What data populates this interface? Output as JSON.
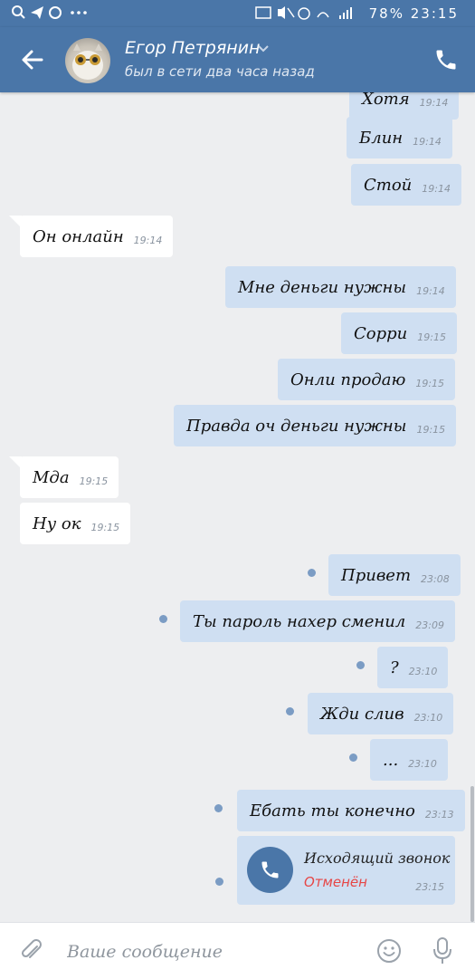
{
  "status_bar": {
    "left_icons": "🔍◢ ⋯",
    "battery": "78%",
    "time": "23:15"
  },
  "header": {
    "contact_name": "Егор Петрянин",
    "contact_status": "был в сети два часа назад",
    "icons": {
      "back": "arrow-left-icon",
      "call": "phone-icon",
      "dropdown": "chevron-down-icon"
    }
  },
  "messages": [
    {
      "id": "m0",
      "dir": "out",
      "text": "Хотя",
      "time": "19:14"
    },
    {
      "id": "m1",
      "dir": "out",
      "text": "Блин",
      "time": "19:14"
    },
    {
      "id": "m2",
      "dir": "out",
      "text": "Стой",
      "time": "19:14"
    },
    {
      "id": "m3",
      "dir": "in",
      "text": "Он онлайн",
      "time": "19:14"
    },
    {
      "id": "m4",
      "dir": "out",
      "text": "Мне деньги нужны",
      "time": "19:14"
    },
    {
      "id": "m5",
      "dir": "out",
      "text": "Сорри",
      "time": "19:15"
    },
    {
      "id": "m6",
      "dir": "out",
      "text": "Онли продаю",
      "time": "19:15"
    },
    {
      "id": "m7",
      "dir": "out",
      "text": "Правда оч деньги нужны",
      "time": "19:15"
    },
    {
      "id": "m8",
      "dir": "in",
      "text": "Мда",
      "time": "19:15"
    },
    {
      "id": "m9",
      "dir": "in",
      "text": "Ну ок",
      "time": "19:15"
    },
    {
      "id": "m10",
      "dir": "out",
      "text": "Привет",
      "time": "23:08",
      "unread": true
    },
    {
      "id": "m11",
      "dir": "out",
      "text": "Ты пароль нахер сменил",
      "time": "23:09",
      "unread": true
    },
    {
      "id": "m12",
      "dir": "out",
      "text": "?",
      "time": "23:10",
      "unread": true
    },
    {
      "id": "m13",
      "dir": "out",
      "text": "Жди слив",
      "time": "23:10",
      "unread": true
    },
    {
      "id": "m14",
      "dir": "out",
      "text": "...",
      "time": "23:10",
      "unread": true
    },
    {
      "id": "m15",
      "dir": "out",
      "text": "Ебать ты конечно",
      "time": "23:13",
      "unread": true
    }
  ],
  "call": {
    "title": "Исходящий звонок",
    "status": "Отменён",
    "time": "23:15",
    "unread": true
  },
  "input": {
    "placeholder": "Ваше сообщение"
  },
  "colors": {
    "header": "#4a76a8",
    "outgoing_bubble": "#cfdff2",
    "incoming_bubble": "#ffffff",
    "background": "#edeef0",
    "cancelled": "#e64646"
  }
}
